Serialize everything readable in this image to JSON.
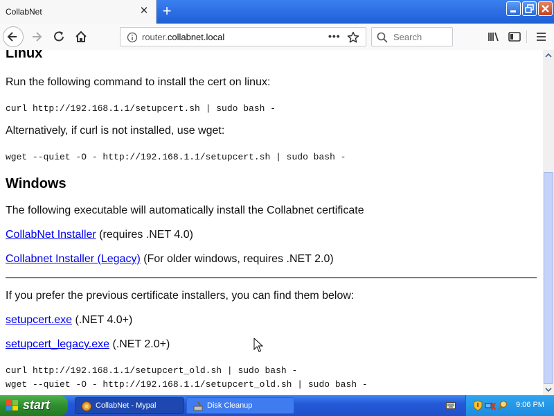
{
  "browser": {
    "tab_title": "CollabNet",
    "url_host": "router.",
    "url_domain": "collabnet.local",
    "search_placeholder": "Search"
  },
  "page": {
    "linux_heading": "Linux",
    "linux_intro": "Run the following command to install the cert on linux:",
    "linux_cmd_curl": "curl http://192.168.1.1/setupcert.sh | sudo bash -",
    "linux_alt": "Alternatively, if curl is not installed, use wget:",
    "linux_cmd_wget": "wget --quiet -O - http://192.168.1.1/setupcert.sh | sudo bash -",
    "windows_heading": "Windows",
    "windows_intro": "The following executable will automatically install the Collabnet certificate",
    "installer_link": "CollabNet Installer",
    "installer_note": " (requires .NET 4.0)",
    "legacy_link": "Collabnet Installer (Legacy)",
    "legacy_note": " (For older windows, requires .NET 2.0)",
    "previous_intro": "If you prefer the previous certificate installers, you can find them below:",
    "setupcert_link": "setupcert.exe",
    "setupcert_note": " (.NET 4.0+)",
    "setupcert_legacy_link": "setupcert_legacy.exe",
    "setupcert_legacy_note": " (.NET 2.0+)",
    "old_cmd_curl": "curl http://192.168.1.1/setupcert_old.sh | sudo bash -",
    "old_cmd_wget": "wget --quiet -O - http://192.168.1.1/setupcert_old.sh | sudo bash -"
  },
  "taskbar": {
    "start_label": "start",
    "task_collabnet": "CollabNet - Mypal",
    "task_cleanup": "Disk Cleanup",
    "clock": "9:06 PM"
  }
}
